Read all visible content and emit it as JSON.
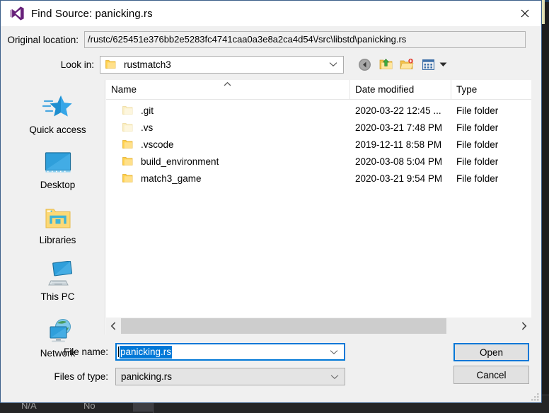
{
  "window": {
    "title": "Find Source: panicking.rs",
    "app_icon": "visual-studio-icon",
    "close_icon": "close-icon"
  },
  "original_location": {
    "label": "Original location:",
    "value": "/rustc/625451e376bb2e5283fc4741caa0a3e8a2ca4d54\\/src\\libstd\\panicking.rs"
  },
  "look_in": {
    "label": "Look in:",
    "value": "rustmatch3",
    "folder_icon": "folder-icon",
    "caret_icon": "chevron-down-icon"
  },
  "toolbar": {
    "back_label": "Back",
    "up_label": "Up one level",
    "new_folder_label": "Create New Folder",
    "views_label": "Views",
    "back_icon": "back-arrow-icon",
    "up_icon": "up-folder-icon",
    "new_folder_icon": "new-folder-icon",
    "views_icon": "views-grid-icon",
    "views_caret_icon": "caret-down-icon"
  },
  "places": {
    "items": [
      {
        "label": "Quick access",
        "icon": "quick-access-star-icon"
      },
      {
        "label": "Desktop",
        "icon": "desktop-monitor-icon"
      },
      {
        "label": "Libraries",
        "icon": "libraries-folder-icon"
      },
      {
        "label": "This PC",
        "icon": "this-pc-computer-icon"
      },
      {
        "label": "Network",
        "icon": "network-globe-icon"
      }
    ]
  },
  "file_list": {
    "columns": [
      "Name",
      "Date modified",
      "Type"
    ],
    "sort_column": "Name",
    "sort_direction": "ascending",
    "sort_icon": "sort-ascending-icon",
    "rows": [
      {
        "name": ".git",
        "date": "2020-03-22 12:45 ...",
        "type": "File folder",
        "icon": "folder-icon",
        "hidden": true
      },
      {
        "name": ".vs",
        "date": "2020-03-21 7:48 PM",
        "type": "File folder",
        "icon": "folder-icon",
        "hidden": true
      },
      {
        "name": ".vscode",
        "date": "2019-12-11 8:58 PM",
        "type": "File folder",
        "icon": "folder-icon",
        "hidden": false
      },
      {
        "name": "build_environment",
        "date": "2020-03-08 5:04 PM",
        "type": "File folder",
        "icon": "folder-icon",
        "hidden": false
      },
      {
        "name": "match3_game",
        "date": "2020-03-21 9:54 PM",
        "type": "File folder",
        "icon": "folder-icon",
        "hidden": false
      }
    ],
    "scrollbar": {
      "left_icon": "chevron-left-icon",
      "right_icon": "chevron-right-icon"
    }
  },
  "form": {
    "filename_label": "File name:",
    "filename_value": "panicking.rs",
    "filename_selected": true,
    "filetype_label": "Files of type:",
    "filetype_value": "panicking.rs",
    "caret_icon": "chevron-down-icon",
    "open_label": "Open",
    "cancel_label": "Cancel",
    "resize_grip_icon": "resize-grip-icon"
  },
  "background": {
    "cell_1": "N/A",
    "cell_2": "No"
  },
  "colors": {
    "accent": "#0078d7",
    "dialog_bg": "#f0f0f0",
    "titlebar_bg": "#ffffff",
    "folder_yellow": "#ffd04b",
    "folder_hidden": "#f5e6a8",
    "desktop_bg": "#1e1e1e"
  }
}
